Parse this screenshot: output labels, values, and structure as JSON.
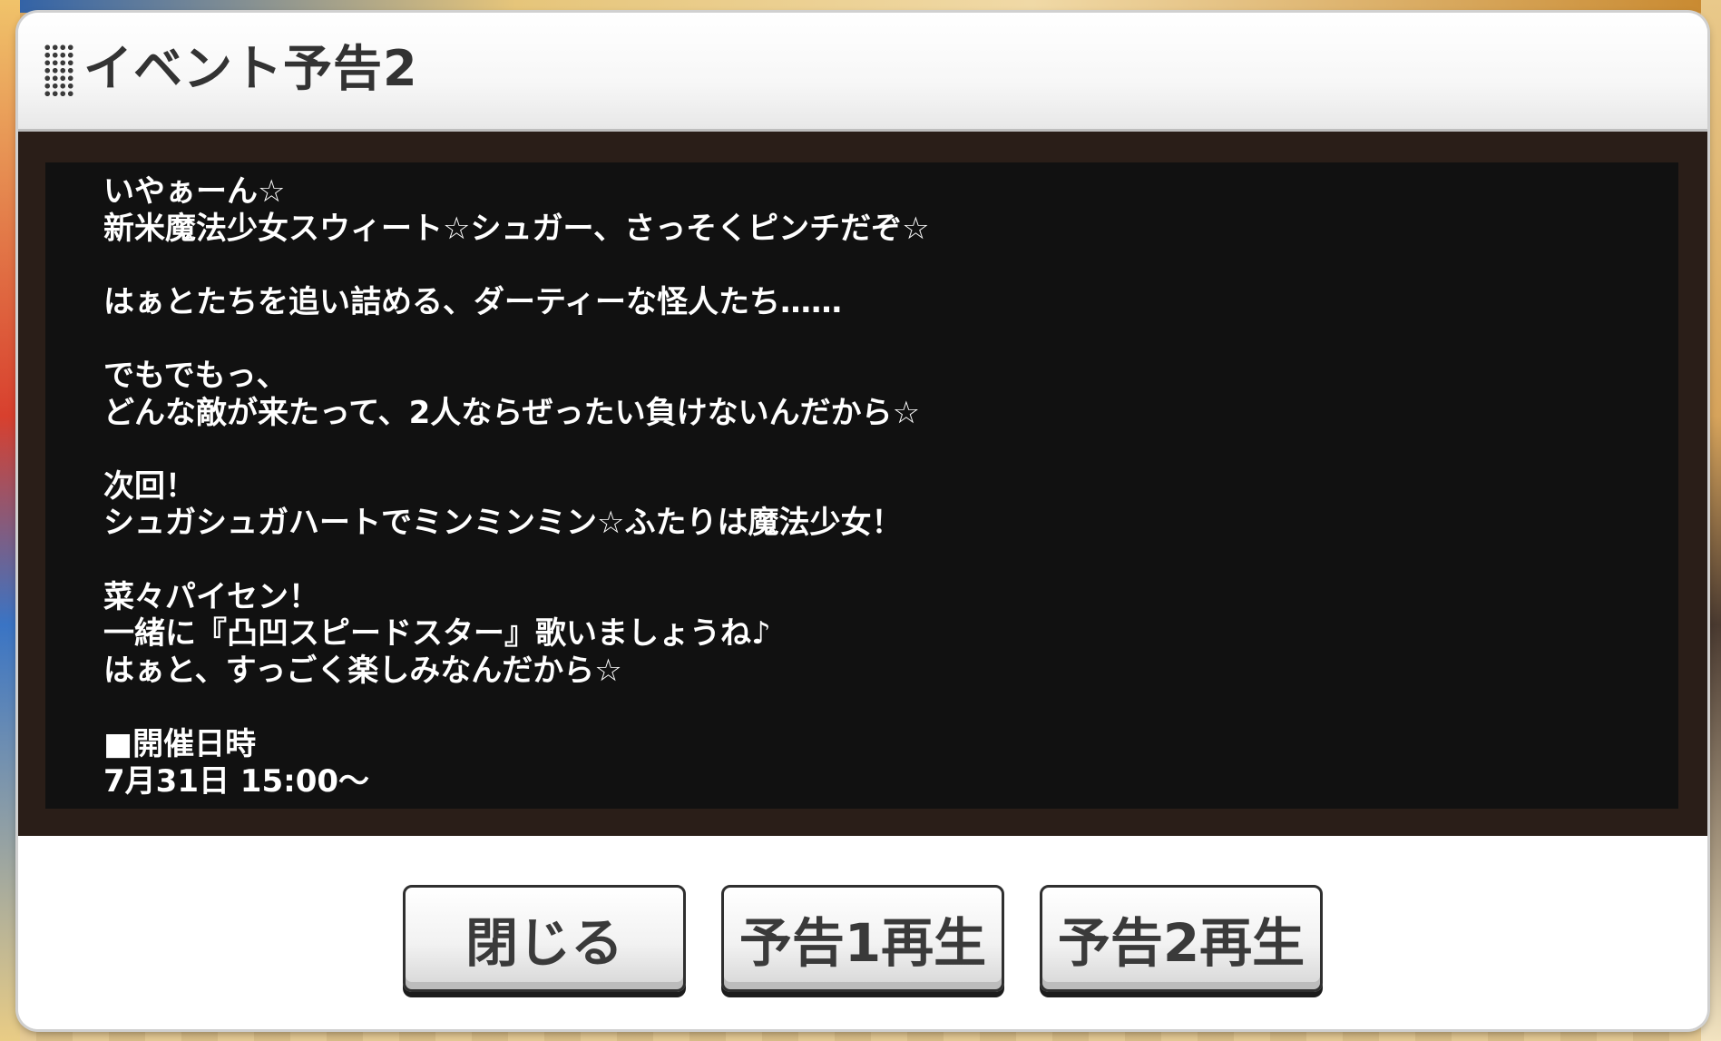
{
  "dialog": {
    "title": "イベント予告2",
    "message": "いやぁーん☆\n新米魔法少女スウィート☆シュガー、さっそくピンチだぞ☆\n\nはぁとたちを追い詰める、ダーティーな怪人たち……\n\nでもでもっ、\nどんな敵が来たって、2人ならぜったい負けないんだから☆\n\n次回！\nシュガシュガハートでミンミンミン☆ふたりは魔法少女！\n\n菜々パイセン！\n一緒に『凸凹スピードスター』歌いましょうね♪\nはぁと、すっごく楽しみなんだから☆\n\n■開催日時\n7月31日 15:00〜"
  },
  "buttons": {
    "close": "閉じる",
    "play_preview_1": "予告1再生",
    "play_preview_2": "予告2再生"
  },
  "icons": {
    "header_grip": "grip-dots-icon"
  }
}
